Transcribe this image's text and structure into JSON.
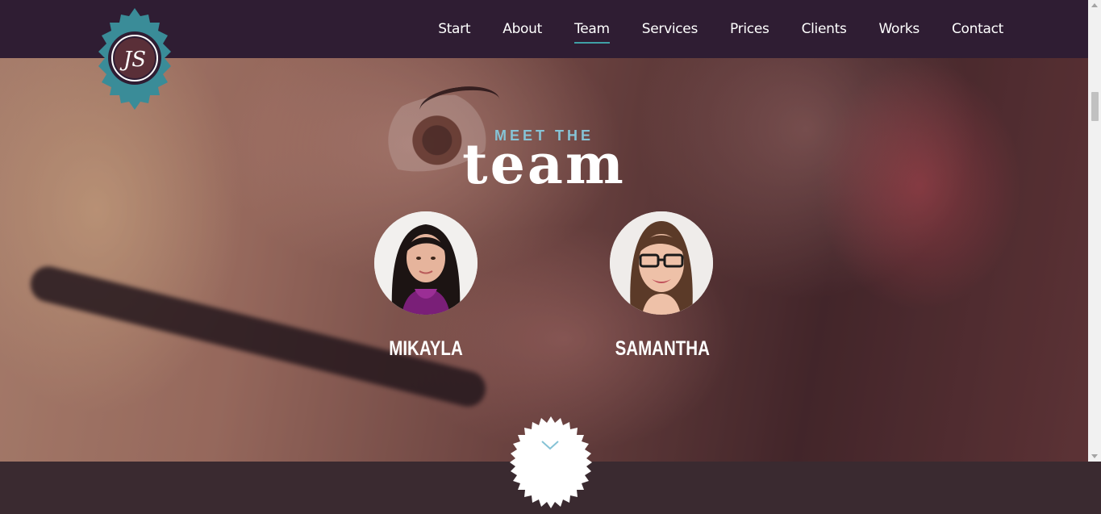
{
  "nav": {
    "items": [
      {
        "label": "Start",
        "active": false
      },
      {
        "label": "About",
        "active": false
      },
      {
        "label": "Team",
        "active": true
      },
      {
        "label": "Services",
        "active": false
      },
      {
        "label": "Prices",
        "active": false
      },
      {
        "label": "Clients",
        "active": false
      },
      {
        "label": "Works",
        "active": false
      },
      {
        "label": "Contact",
        "active": false
      }
    ]
  },
  "logo": {
    "monogram": "JS",
    "frame_color": "#3a8c98"
  },
  "section": {
    "kicker": "MEET THE",
    "title": "team"
  },
  "team": [
    {
      "name": "MIKAYLA"
    },
    {
      "name": "SAMANTHA"
    }
  ],
  "colors": {
    "nav_bg": "#2f1d33",
    "accent": "#3fa0a6",
    "kicker": "#86c3d6"
  },
  "icons": {
    "scroll": "chevron-down-icon"
  }
}
